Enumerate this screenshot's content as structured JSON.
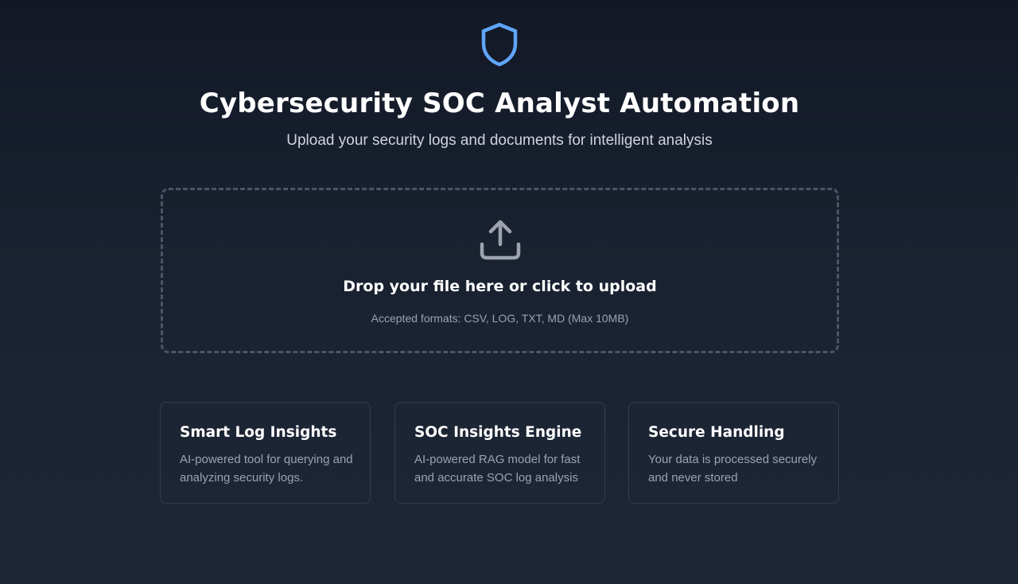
{
  "header": {
    "icon": "shield-icon",
    "title": "Cybersecurity SOC Analyst Automation",
    "subtitle": "Upload your security logs and documents for intelligent analysis"
  },
  "upload": {
    "icon": "upload-icon",
    "title": "Drop your file here or click to upload",
    "formats": "Accepted formats: CSV, LOG, TXT, MD (Max 10MB)"
  },
  "features": [
    {
      "title": "Smart Log Insights",
      "description": "AI-powered tool for querying and analyzing security logs."
    },
    {
      "title": "SOC Insights Engine",
      "description": "AI-powered RAG model for fast and accurate SOC log analysis"
    },
    {
      "title": "Secure Handling",
      "description": "Your data is processed securely and never stored"
    }
  ],
  "colors": {
    "accent": "#60a5fa",
    "background": "#1a2231",
    "muted_text": "#9aa3b0",
    "dropzone_border": "#4b5563"
  }
}
